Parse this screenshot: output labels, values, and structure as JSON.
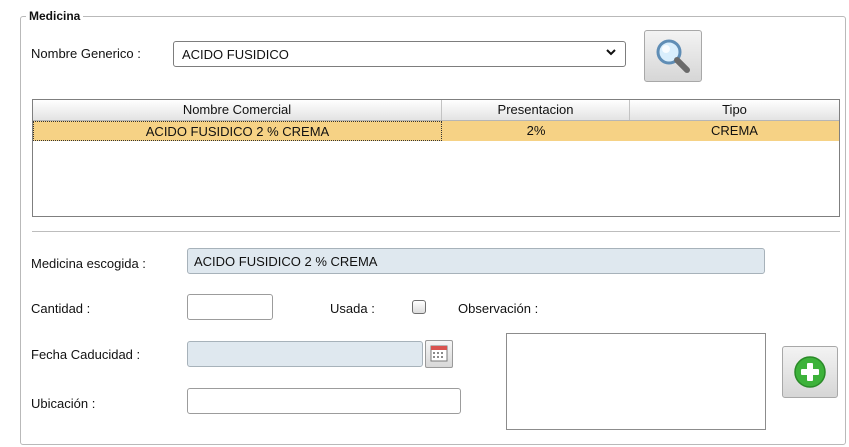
{
  "group": {
    "title": "Medicina"
  },
  "generic": {
    "label": "Nombre Generico :",
    "selected": "ACIDO FUSIDICO"
  },
  "table": {
    "columns": [
      "Nombre Comercial",
      "Presentacion",
      "Tipo"
    ],
    "rows": [
      [
        "ACIDO FUSIDICO 2 % CREMA",
        "2%",
        "CREMA"
      ]
    ]
  },
  "form": {
    "medicina_escogida_label": "Medicina escogida :",
    "medicina_escogida_value": "ACIDO FUSIDICO 2 % CREMA",
    "cantidad_label": "Cantidad :",
    "cantidad_value": "",
    "usada_label": "Usada :",
    "usada_checked": false,
    "observacion_label": "Observación :",
    "observacion_value": "",
    "fecha_caducidad_label": "Fecha Caducidad :",
    "fecha_caducidad_value": "",
    "ubicacion_label": "Ubicación :",
    "ubicacion_value": ""
  },
  "icons": {
    "search": "magnifier-icon",
    "calendar": "calendar-icon",
    "add": "plus-circle-icon",
    "chevron": "chevron-down-icon"
  },
  "colors": {
    "selected_row": "#f6d285",
    "readonly_field": "#dfe8ef",
    "add_green": "#3db23a"
  }
}
